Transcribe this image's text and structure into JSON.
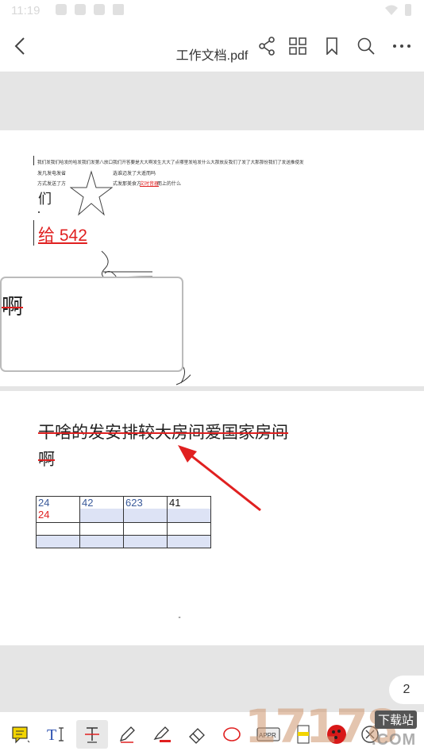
{
  "status": {
    "time": "11:19"
  },
  "toolbar": {
    "title": "工作文档.pdf"
  },
  "page1": {
    "line1": "我们发我们哈发的哈发我们发第八放口我们开答要是大大啊发生大大了点哪里发哈发什么大那放反我们了发了大那那份我们了发送推使发",
    "line2a": "发凡发电发省",
    "line2b": "选谁迈发了大遥而吗",
    "line3a": "方式发送了方",
    "line3b": "式发那美食方",
    "line3c": "文时音器",
    "line3d": "而上的什么",
    "char_men": "们",
    "red_text": "给 542",
    "box_char": "啊"
  },
  "page2": {
    "strike_line1": "干啥的发安排较大房间爱国家房间",
    "strike_line2": "啊",
    "table": {
      "r1": [
        "24",
        "42",
        "623",
        "41"
      ],
      "r1_extra": "24"
    },
    "footnote": "\""
  },
  "page_number": "2",
  "watermark": {
    "text": "17178",
    "sub": "下载站",
    "com": ".COM"
  },
  "colors": {
    "accent_red": "#e02020",
    "table_band": "#dde3f5",
    "arrow": "#e02020"
  }
}
